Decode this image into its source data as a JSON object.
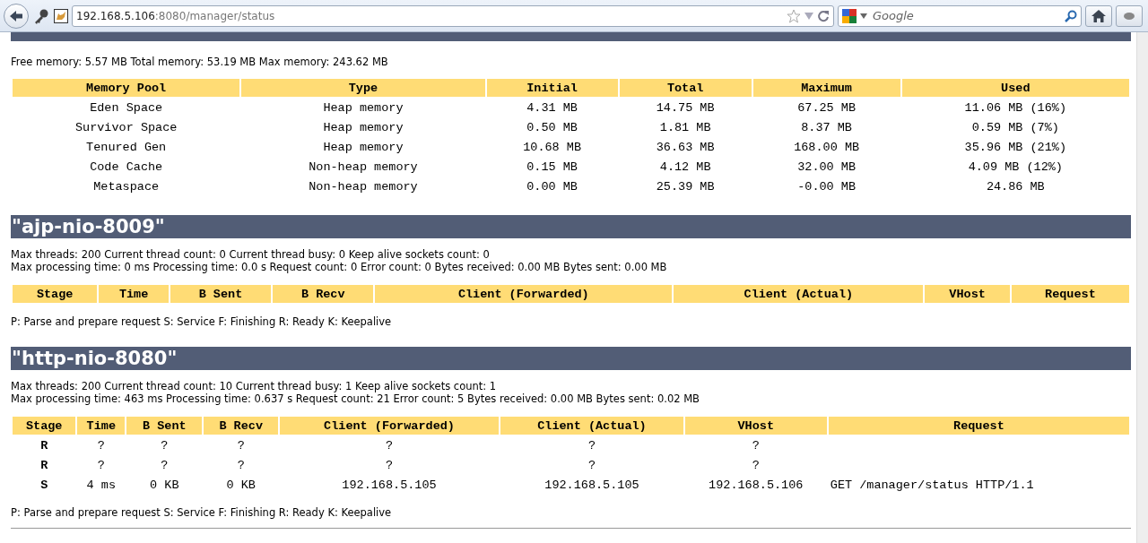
{
  "browser": {
    "url_host": "192.168.5.106",
    "url_rest": ":8080/manager/status",
    "search_placeholder": "Google"
  },
  "jvm": {
    "memory_line": "Free memory: 5.57 MB Total memory: 53.19 MB Max memory: 243.62 MB",
    "table": {
      "columns": [
        "Memory Pool",
        "Type",
        "Initial",
        "Total",
        "Maximum",
        "Used"
      ],
      "rows": [
        [
          "Eden Space",
          "Heap memory",
          "4.31 MB",
          "14.75 MB",
          "67.25 MB",
          "11.06 MB (16%)"
        ],
        [
          "Survivor Space",
          "Heap memory",
          "0.50 MB",
          "1.81 MB",
          "8.37 MB",
          "0.59 MB (7%)"
        ],
        [
          "Tenured Gen",
          "Heap memory",
          "10.68 MB",
          "36.63 MB",
          "168.00 MB",
          "35.96 MB (21%)"
        ],
        [
          "Code Cache",
          "Non-heap memory",
          "0.15 MB",
          "4.12 MB",
          "32.00 MB",
          "4.09 MB (12%)"
        ],
        [
          "Metaspace",
          "Non-heap memory",
          "0.00 MB",
          "25.39 MB",
          "-0.00 MB",
          "24.86 MB"
        ]
      ]
    }
  },
  "connectors": [
    {
      "title": "\"ajp-nio-8009\"",
      "lines": [
        "Max threads: 200 Current thread count: 0 Current thread busy: 0 Keep alive sockets count: 0",
        "Max processing time: 0 ms Processing time: 0.0 s Request count: 0 Error count: 0 Bytes received: 0.00 MB Bytes sent: 0.00 MB"
      ],
      "columns": [
        "Stage",
        "Time",
        "B Sent",
        "B Recv",
        "Client (Forwarded)",
        "Client (Actual)",
        "VHost",
        "Request"
      ],
      "legend": "P: Parse and prepare request S: Service F: Finishing R: Ready K: Keepalive"
    },
    {
      "title": "\"http-nio-8080\"",
      "lines": [
        "Max threads: 200 Current thread count: 10 Current thread busy: 1 Keep alive sockets count: 1",
        "Max processing time: 463 ms Processing time: 0.637 s Request count: 21 Error count: 5 Bytes received: 0.00 MB Bytes sent: 0.02 MB"
      ],
      "columns": [
        "Stage",
        "Time",
        "B Sent",
        "B Recv",
        "Client (Forwarded)",
        "Client (Actual)",
        "VHost",
        "Request"
      ],
      "rows": [
        [
          "R",
          "?",
          "?",
          "?",
          "?",
          "?",
          "?",
          ""
        ],
        [
          "R",
          "?",
          "?",
          "?",
          "?",
          "?",
          "?",
          ""
        ],
        [
          "S",
          "4 ms",
          "0 KB",
          "0 KB",
          "192.168.5.105",
          "192.168.5.105",
          "192.168.5.106",
          "GET /manager/status HTTP/1.1"
        ]
      ],
      "legend": "P: Parse and prepare request S: Service F: Finishing R: Ready K: Keepalive"
    }
  ]
}
